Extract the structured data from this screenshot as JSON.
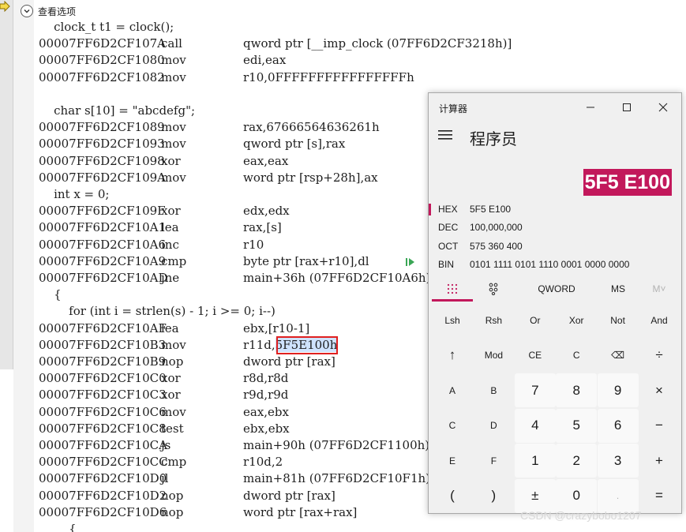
{
  "editor": {
    "view_options": "查看选项",
    "lines": [
      {
        "type": "src",
        "text": "    clock_t t1 = clock();"
      },
      {
        "type": "asm",
        "addr": "00007FF6D2CF107A",
        "mn": "call",
        "op": "qword ptr [__imp_clock (07FF6D2CF3218h)]"
      },
      {
        "type": "asm",
        "addr": "00007FF6D2CF1080",
        "mn": "mov",
        "op": "edi,eax"
      },
      {
        "type": "asm",
        "addr": "00007FF6D2CF1082",
        "mn": "mov",
        "op": "r10,0FFFFFFFFFFFFFFFFh"
      },
      {
        "type": "blank"
      },
      {
        "type": "src",
        "text": "    char s[10] = \"abcdefg\";"
      },
      {
        "type": "asm",
        "addr": "00007FF6D2CF1089",
        "mn": "mov",
        "op": "rax,67666564636261h"
      },
      {
        "type": "asm",
        "addr": "00007FF6D2CF1093",
        "mn": "mov",
        "op": "qword ptr [s],rax"
      },
      {
        "type": "asm",
        "addr": "00007FF6D2CF1098",
        "mn": "xor",
        "op": "eax,eax"
      },
      {
        "type": "asm",
        "addr": "00007FF6D2CF109A",
        "mn": "mov",
        "op": "word ptr [rsp+28h],ax"
      },
      {
        "type": "src",
        "text": "    int x = 0;"
      },
      {
        "type": "asm",
        "addr": "00007FF6D2CF109F",
        "mn": "xor",
        "op": "edx,edx"
      },
      {
        "type": "asm",
        "addr": "00007FF6D2CF10A1",
        "mn": "lea",
        "op": "rax,[s]"
      },
      {
        "type": "asm",
        "addr": "00007FF6D2CF10A6",
        "mn": "inc",
        "op": "r10"
      },
      {
        "type": "asm",
        "addr": "00007FF6D2CF10A9",
        "mn": "cmp",
        "op": "byte ptr [rax+r10],dl"
      },
      {
        "type": "asm",
        "addr": "00007FF6D2CF10AD",
        "mn": "jne",
        "op": "main+36h (07FF6D2CF10A6h)"
      },
      {
        "type": "src",
        "text": "    {"
      },
      {
        "type": "src",
        "text": "        for (int i = strlen(s) - 1; i >= 0; i--)"
      },
      {
        "type": "asm",
        "addr": "00007FF6D2CF10AF",
        "mn": "lea",
        "op": "ebx,[r10-1]"
      },
      {
        "type": "asm",
        "addr": "00007FF6D2CF10B3",
        "mn": "mov",
        "op": "r11d,",
        "highlight": "5F5E100h"
      },
      {
        "type": "asm",
        "addr": "00007FF6D2CF10B9",
        "mn": "nop",
        "op": "dword ptr [rax]"
      },
      {
        "type": "asm",
        "addr": "00007FF6D2CF10C0",
        "mn": "xor",
        "op": "r8d,r8d"
      },
      {
        "type": "asm",
        "addr": "00007FF6D2CF10C3",
        "mn": "xor",
        "op": "r9d,r9d"
      },
      {
        "type": "asm",
        "addr": "00007FF6D2CF10C6",
        "mn": "mov",
        "op": "eax,ebx"
      },
      {
        "type": "asm",
        "addr": "00007FF6D2CF10C8",
        "mn": "test",
        "op": "ebx,ebx"
      },
      {
        "type": "asm",
        "addr": "00007FF6D2CF10CA",
        "mn": "js",
        "op": "main+90h (07FF6D2CF1100h)"
      },
      {
        "type": "asm",
        "addr": "00007FF6D2CF10CC",
        "mn": "cmp",
        "op": "r10d,2"
      },
      {
        "type": "asm",
        "addr": "00007FF6D2CF10D0",
        "mn": "jl",
        "op": "main+81h (07FF6D2CF10F1h)"
      },
      {
        "type": "asm",
        "addr": "00007FF6D2CF10D2",
        "mn": "nop",
        "op": "dword ptr [rax]"
      },
      {
        "type": "asm",
        "addr": "00007FF6D2CF10D6",
        "mn": "nop",
        "op": "word ptr [rax+rax]"
      },
      {
        "type": "src",
        "text": "        {"
      }
    ]
  },
  "calculator": {
    "title": "计算器",
    "mode": "程序员",
    "display": "5F5 E100",
    "bases": [
      {
        "name": "HEX",
        "value": "5F5 E100",
        "active": true
      },
      {
        "name": "DEC",
        "value": "100,000,000"
      },
      {
        "name": "OCT",
        "value": "575 360 400"
      },
      {
        "name": "BIN",
        "value": "0101 1111 0101 1110 0001 0000 0000"
      }
    ],
    "word_size": "QWORD",
    "ms": "MS",
    "mr": "M˅",
    "keys": [
      [
        "Lsh",
        "Rsh",
        "Or",
        "Xor",
        "Not",
        "And"
      ],
      [
        "↑",
        "Mod",
        "CE",
        "C",
        "⌫",
        "÷"
      ],
      [
        "A",
        "B",
        "7",
        "8",
        "9",
        "×"
      ],
      [
        "C",
        "D",
        "4",
        "5",
        "6",
        "−"
      ],
      [
        "E",
        "F",
        "1",
        "2",
        "3",
        "+"
      ],
      [
        "(",
        ")",
        "±",
        "0",
        ".",
        "="
      ]
    ],
    "accent": "#c2185b"
  },
  "watermark": "CSDN @crazybobo1207"
}
